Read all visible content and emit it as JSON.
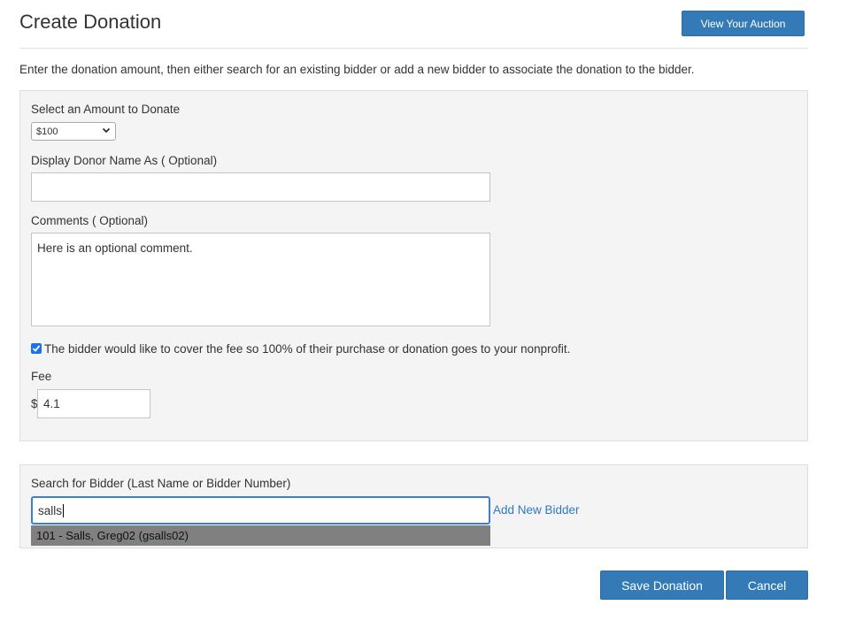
{
  "header": {
    "title": "Create Donation",
    "view_auction_label": "View Your Auction"
  },
  "intro_text": "Enter the donation amount, then either search for an existing bidder or add a new bidder to associate the donation to the bidder.",
  "donation_form": {
    "amount_label": "Select an Amount to Donate",
    "amount_value": "$100",
    "donor_name_label": "Display Donor Name As ( Optional)",
    "donor_name_value": "",
    "comments_label": "Comments ( Optional)",
    "comments_value": "Here is an optional comment.",
    "cover_fee_checked": true,
    "cover_fee_label": "The bidder would like to cover the fee so 100% of their purchase or donation goes to your nonprofit.",
    "fee_label": "Fee",
    "fee_prefix": "$",
    "fee_value": "4.1"
  },
  "bidder_search": {
    "label": "Search for Bidder (Last Name or Bidder Number)",
    "value": "salls",
    "add_new_label": "Add New Bidder",
    "suggestion": "101 - Salls, Greg02 (gsalls02)"
  },
  "actions": {
    "save_label": "Save Donation",
    "cancel_label": "Cancel"
  },
  "colors": {
    "primary": "#337ab7",
    "link": "#2f78c4",
    "panel_bg": "#f4f4f4",
    "suggest_bg": "#808080"
  },
  "icons": {
    "select_arrow": "chevron-down-icon",
    "checkbox": "checkmark-icon"
  }
}
